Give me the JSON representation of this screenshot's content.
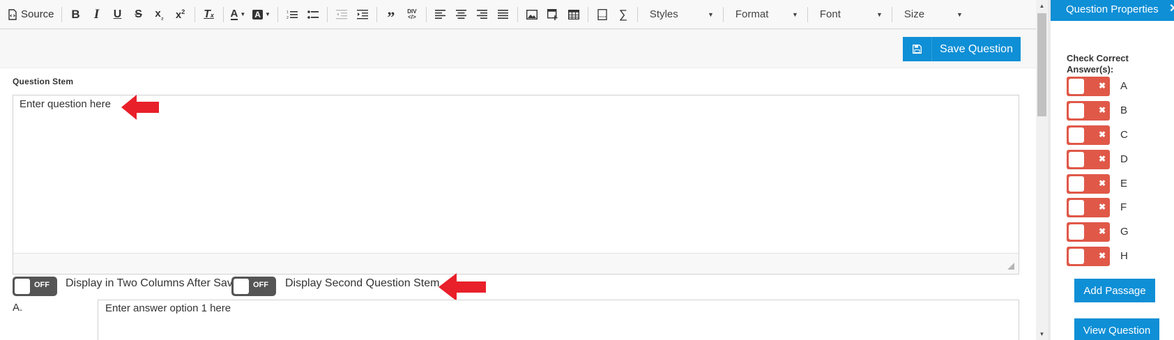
{
  "toolbar": {
    "source_label": "Source",
    "styles_label": "Styles",
    "format_label": "Format",
    "font_label": "Font",
    "size_label": "Size"
  },
  "save_button": {
    "label": "Save Question"
  },
  "question_stem": {
    "label": "Question Stem",
    "text": "Enter question here"
  },
  "toggles": [
    {
      "state": "OFF",
      "label": "Display in Two Columns After Save"
    },
    {
      "state": "OFF",
      "label": "Display Second Question Stem"
    }
  ],
  "answer_option": {
    "label": "A.",
    "text": "Enter answer option 1 here"
  },
  "panel": {
    "title": "Question Properties",
    "close_glyph": "✕",
    "check_label": "Check Correct Answer(s):",
    "answers": [
      "A",
      "B",
      "C",
      "D",
      "E",
      "F",
      "G",
      "H"
    ],
    "add_passage_label": "Add Passage",
    "view_question_label": "View Question"
  },
  "colors": {
    "accent": "#0e8fd6",
    "toggle_off": "#555555",
    "answer_toggle": "#e05848",
    "arrow": "#e8202a"
  }
}
